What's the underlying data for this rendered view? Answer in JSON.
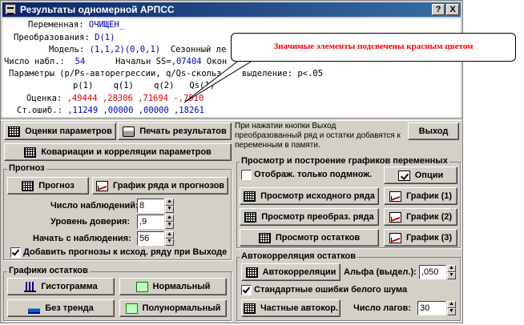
{
  "window": {
    "title": "Результаты одномерной АРПСС",
    "help_btn": "?",
    "close_btn": "X"
  },
  "output": {
    "line1_label": "Переменная:",
    "line1_value": "ОЧИЩЕН_",
    "line2_label": "Преобразования:",
    "line2_value": "D(1)",
    "line3_label": "Модель:",
    "line3_value": "(1,1,2)(0,0,1)",
    "line3_tail": "Сезонный ле",
    "line4_label": "Число набл.:",
    "line4_value": "54",
    "line4_mid": "Начальн SS=",
    "line4_mid_value": ",07404",
    "line4_tail": "Окон",
    "line5": "Параметры (p/Ps-авторегрессии, q/Qs-скольз.",
    "line5_tail": "выделение: p<.05",
    "headers": "p(1)    q(1)    q(2)   Qs(1)",
    "est_label": "Оценка:",
    "est_values": ",49444 ,28306 ,71694 -,7510",
    "se_label": "Ст.ошиб.:",
    "se_values": ",11249 ,00000 ,00000 ,18261"
  },
  "callout": "Значимые элементы подсвечены красным цветом",
  "buttons": {
    "estimates": "Оценки параметров",
    "print": "Печать результатов",
    "exit": "Выход",
    "cov": "Ковариации и корреляции параметров",
    "forecast": "Прогноз",
    "forecast_plot": "График ряда и прогнозов",
    "view_orig": "Просмотр исходного ряда",
    "view_trans": "Просмотр преобраз. ряда",
    "view_resid": "Просмотр остатков",
    "options": "Опции",
    "plot1": "График (1)",
    "plot2": "График (2)",
    "plot3": "График (3)",
    "hist": "Гистограмма",
    "normal": "Нормальный",
    "detrend": "Без тренда",
    "halfnormal": "Полунормальный",
    "autocorr": "Автокорреляции",
    "partial": "Частные автокор."
  },
  "info_text": "При нажатии кнопки Выход преобразованный ряд и остатки добавятся к переменным в памяти.",
  "forecast": {
    "title": "Прогноз",
    "n_label": "Число наблюдений:",
    "n_value": "8",
    "conf_label": "Уровень доверия:",
    "conf_value": ",9",
    "start_label": "Начать с наблюдения:",
    "start_value": "56",
    "append_label": "Добавить прогнозы к исход. ряду при Выходе",
    "append_checked": true
  },
  "plots": {
    "title": "Просмотр и построение графиков переменных",
    "subset_label": "Отображ. только подмнож.",
    "subset_checked": false
  },
  "resid": {
    "title": "Графики остатков"
  },
  "autocorr": {
    "title": "Автокорреляция остатков",
    "alpha_label": "Альфа (выдел.):",
    "alpha_value": ",050",
    "white_noise_label": "Стандартные ошибки белого шума",
    "white_noise_checked": true,
    "lags_label": "Число лагов:",
    "lags_value": "30"
  }
}
